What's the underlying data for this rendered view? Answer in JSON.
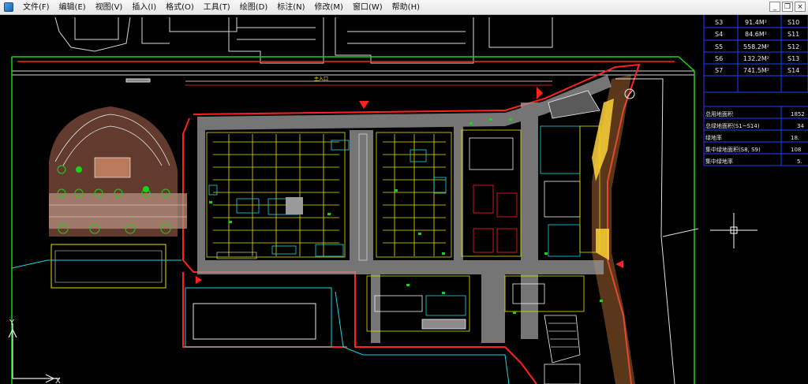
{
  "menubar": {
    "app_icon": "autocad-app-icon",
    "items": [
      "文件(F)",
      "编辑(E)",
      "视图(V)",
      "插入(I)",
      "格式(O)",
      "工具(T)",
      "绘图(D)",
      "标注(N)",
      "修改(M)",
      "窗口(W)",
      "帮助(H)"
    ]
  },
  "window_controls": {
    "minimize": "_",
    "restore": "❐",
    "close": "×"
  },
  "drawing": {
    "entrance_label": "主入口"
  },
  "area_table": {
    "rows": [
      {
        "id": "S3",
        "area": "91.4M²",
        "ref": "S10"
      },
      {
        "id": "S4",
        "area": "84.6M²",
        "ref": "S11"
      },
      {
        "id": "S5",
        "area": "558.2M²",
        "ref": "S12"
      },
      {
        "id": "S6",
        "area": "132.2M²",
        "ref": "S13"
      },
      {
        "id": "S7",
        "area": "741.5M²",
        "ref": "S14"
      }
    ],
    "summary": [
      {
        "label": "总用地面积",
        "value": "1852"
      },
      {
        "label": "总绿地面积(S1~S14)",
        "value": "34"
      },
      {
        "label": "绿地率",
        "value": "18."
      },
      {
        "label": "集中绿地面积(S8, S9)",
        "value": "108"
      },
      {
        "label": "集中绿地率",
        "value": "5."
      }
    ]
  },
  "ucs_icon": {
    "y_label": "Y",
    "x_label": "X"
  },
  "colors": {
    "background": "#000000",
    "site_boundary": "#19d219",
    "building_outline": "#ff2020",
    "cyan_lines": "#19d6e0",
    "yellow_lines": "#e8e000",
    "table_lines": "#1f3fff"
  }
}
